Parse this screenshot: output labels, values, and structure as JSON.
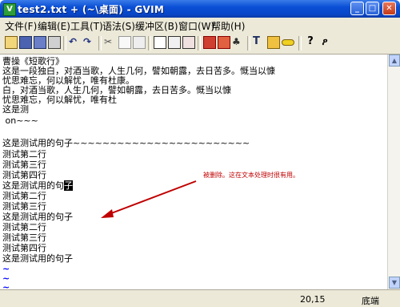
{
  "window": {
    "title": "test2.txt + (~\\桌面) - GVIM"
  },
  "menubar": [
    "文件(F)",
    "编辑(E)",
    "工具(T)",
    "语法(S)",
    "缓冲区(B)",
    "窗口(W)",
    "帮助(H)"
  ],
  "toolbar": {
    "icons": [
      "open-icon",
      "save-icon",
      "save-all-icon",
      "print-icon",
      "undo-icon",
      "redo-icon",
      "cut-icon",
      "copy-icon",
      "paste-icon",
      "find-replace-icon",
      "find-next-icon",
      "find-prev-icon",
      "load-session-icon",
      "save-session-icon",
      "run-script-icon",
      "make-icon",
      "shell-icon",
      "ctags-icon",
      "tag-jump-icon",
      "help-icon",
      "find-help-icon"
    ]
  },
  "editor": {
    "lines": [
      "曹操《短歌行》",
      "这是一段独白，对酒当歌，人生几何，譬如朝露，去日苦多。慨当以慷",
      "忧思难忘，何以解忧，唯有杜康。",
      "白，对酒当歌，人生几何，譬如朝露，去日苦多。慨当以慷",
      "忧思难忘，何以解忧，唯有杜",
      "这是测",
      " on~~~",
      "",
      "这是测试用的句子~~~~~~~~~~~~~~~~~~~~~~~~",
      "测试第二行",
      "测试第三行",
      "测试第四行",
      "这是测试用的句",
      "测试第二行",
      "测试第三行",
      "这是测试用的句子",
      "测试第二行",
      "测试第三行",
      "测试第四行",
      "这是测试用的句子"
    ],
    "cursor_char": "子",
    "tilde_lines": [
      "~",
      "~",
      "~"
    ]
  },
  "annotation": {
    "text": "被删除。这在文本处理时很有用。",
    "color": "#c00000"
  },
  "statusbar": {
    "position": "20,15",
    "scroll": "底端"
  }
}
